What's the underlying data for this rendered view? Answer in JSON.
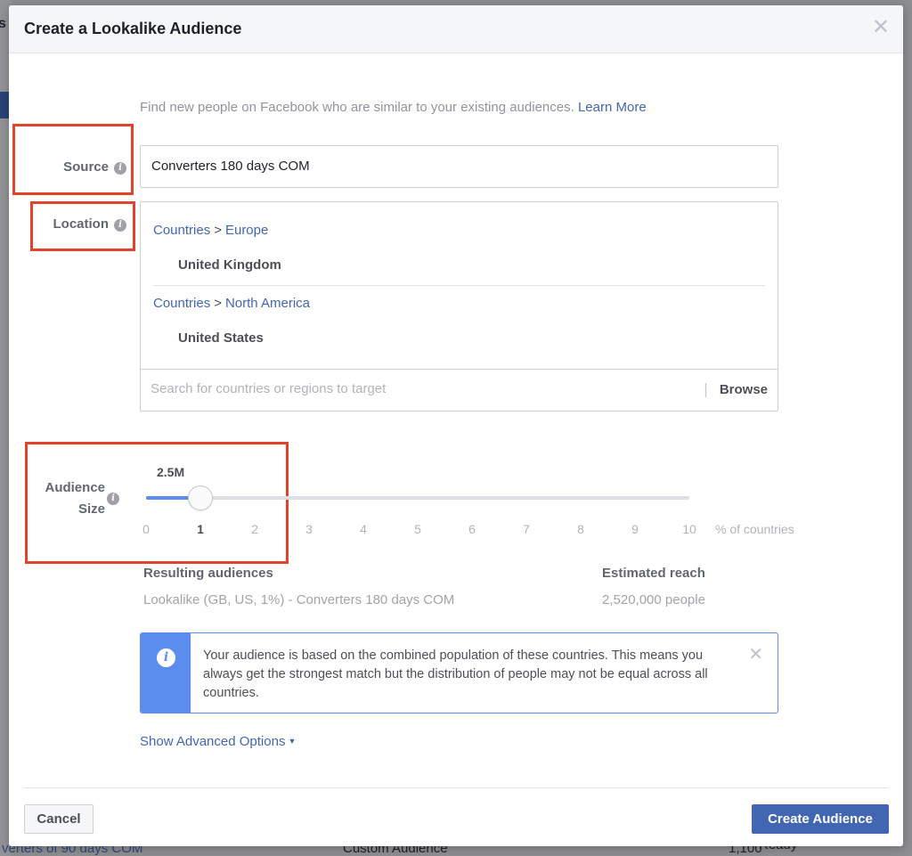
{
  "background": {
    "left_tab_fragment": "s",
    "bottom_row": {
      "name_fragment": "verters of 90 days COM",
      "type": "Custom Audience",
      "size": "1,100",
      "status": "Ready"
    }
  },
  "modal": {
    "title": "Create a Lookalike Audience",
    "close_icon": "close-icon",
    "intro_text": "Find new people on Facebook who are similar to your existing audiences.",
    "learn_more_label": "Learn More",
    "source": {
      "label": "Source",
      "value": "Converters 180 days COM"
    },
    "location": {
      "label": "Location",
      "groups": [
        {
          "path": [
            "Countries",
            "Europe"
          ],
          "country": "United Kingdom"
        },
        {
          "path": [
            "Countries",
            "North America"
          ],
          "country": "United States"
        }
      ],
      "path_separator": ">",
      "search_placeholder": "Search for countries or regions to target",
      "browse_label": "Browse"
    },
    "audience_size": {
      "label_line1": "Audience",
      "label_line2": "Size",
      "selected_value_label": "2.5M",
      "slider_value": 1,
      "slider_min": 0,
      "slider_max": 10,
      "ticks": [
        "0",
        "1",
        "2",
        "3",
        "4",
        "5",
        "6",
        "7",
        "8",
        "9",
        "10"
      ],
      "unit_label": "% of countries"
    },
    "results": {
      "resulting_heading": "Resulting audiences",
      "resulting_value": "Lookalike (GB, US, 1%) - Converters 180 days COM",
      "reach_heading": "Estimated reach",
      "reach_value": "2,520,000 people"
    },
    "notice": {
      "text": "Your audience is based on the combined population of these countries. This means you always get the strongest match but the distribution of people may not be equal across all countries."
    },
    "advanced_options_label": "Show Advanced Options",
    "cancel_label": "Cancel",
    "create_label": "Create Audience"
  },
  "colors": {
    "accent_blue": "#4267b2",
    "slider_blue": "#5b8def",
    "highlight_red": "#e2432c"
  }
}
